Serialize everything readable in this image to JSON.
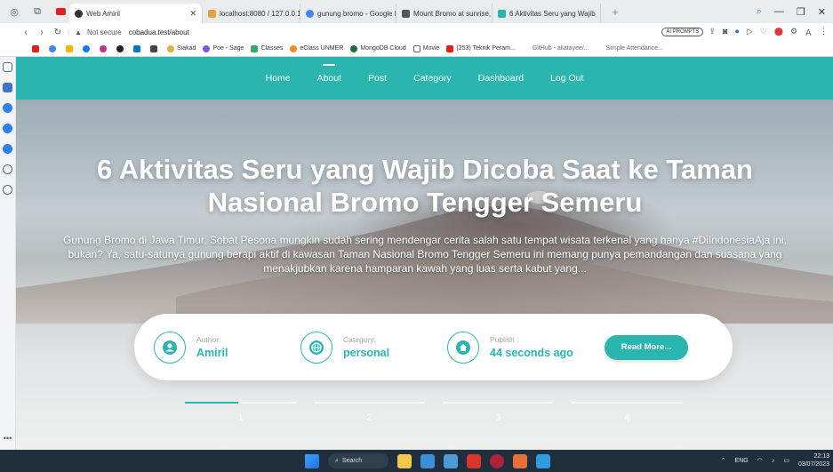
{
  "browser": {
    "tabs": [
      {
        "label": "Web Amiril",
        "favicon_color": "#333333",
        "active": true
      },
      {
        "label": "localhost:8080 / 127.0.0.1 /",
        "favicon_color": "#e8a33d",
        "active": false
      },
      {
        "label": "gunung bromo - Google P",
        "favicon_color": "#4285f4",
        "active": false
      },
      {
        "label": "Mount Bromo at sunrise, w",
        "favicon_color": "#555555",
        "active": false
      },
      {
        "label": "6 Aktivitas Seru yang Wajib",
        "favicon_color": "#2ab5ae",
        "active": false
      }
    ],
    "address": {
      "security": "Not secure",
      "url": "cobadua.test/about",
      "ai_badge": "AI PROMPTS"
    },
    "bookmarks": [
      {
        "label": "Siakad",
        "color": "#d8b43b"
      },
      {
        "label": "Poe - Sage",
        "color": "#7c5cd6"
      },
      {
        "label": "Classes",
        "color": "#3aa76d"
      },
      {
        "label": "eClass UNMER",
        "color": "#f08a24"
      },
      {
        "label": "MongoDB Cloud",
        "color": "#1f6b3b"
      },
      {
        "label": "Movie",
        "color": "#666666"
      },
      {
        "label": "(253) Teknik Peram...",
        "color": "#e02020"
      },
      {
        "label": "GitHub - aliatayee/...",
        "color": "#333333"
      },
      {
        "label": "Simple Attendance...",
        "color": "#777777"
      }
    ]
  },
  "site": {
    "nav": [
      {
        "label": "Home",
        "active": false
      },
      {
        "label": "About",
        "active": true
      },
      {
        "label": "Post",
        "active": false
      },
      {
        "label": "Category",
        "active": false
      },
      {
        "label": "Dashboard",
        "active": false
      },
      {
        "label": "Log Out",
        "active": false
      }
    ],
    "hero": {
      "title": "6 Aktivitas Seru yang Wajib Dicoba Saat ke Taman Nasional Bromo Tengger Semeru",
      "excerpt": "Gunung Bromo di Jawa Timur, Sobat Pesona mungkin sudah sering mendengar cerita salah satu tempat wisata terkenal yang hanya #DiIndonesiaAja ini, bukan? Ya, satu-satunya gunung berapi aktif di kawasan Taman Nasional Bromo Tengger Semeru ini memang punya pemandangan dan suasana yang menakjubkan karena hamparan kawah yang luas serta kabut yang..."
    },
    "info": {
      "author_label": "Author:",
      "author": "Amiril",
      "category_label": "Category:",
      "category": "personal",
      "publish_label": "Publish :",
      "publish": "44 seconds ago",
      "read_more": "Read More..."
    },
    "slides": [
      "1",
      "2",
      "3",
      "4"
    ],
    "active_slide": 1,
    "accent": "#2ab5ae"
  },
  "taskbar": {
    "search": "Search",
    "lang": "ENG",
    "time": "22:13",
    "date": "03/07/2023"
  }
}
